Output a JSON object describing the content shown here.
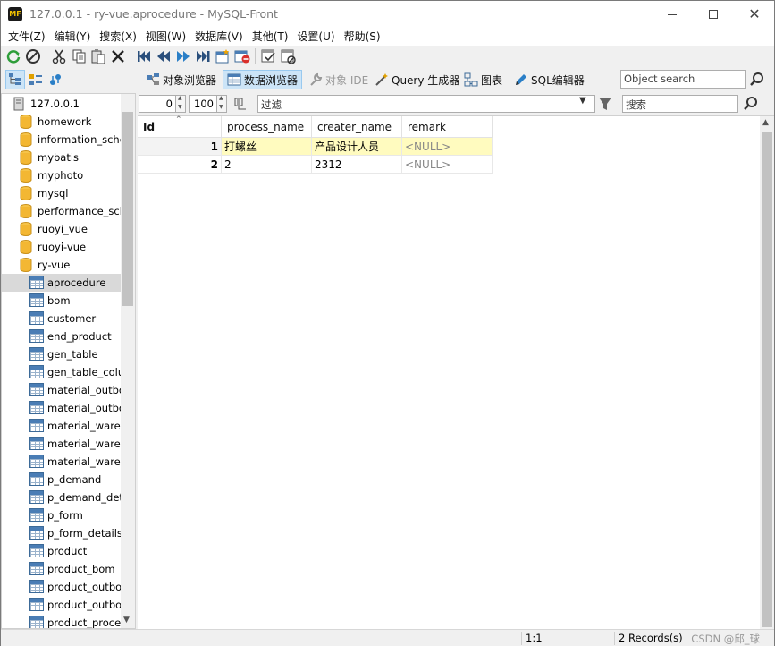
{
  "window": {
    "title": "127.0.0.1 - ry-vue.aprocedure - MySQL-Front",
    "app_icon_text": "MF"
  },
  "menu": [
    "文件(Z)",
    "编辑(Y)",
    "搜索(X)",
    "视图(W)",
    "数据库(V)",
    "其他(T)",
    "设置(U)",
    "帮助(S)"
  ],
  "toolbar_icons": [
    "refresh-icon",
    "stop-icon",
    "cut-icon",
    "copy-icon",
    "paste-icon",
    "delete-icon",
    "first-icon",
    "prev-icon",
    "next-icon",
    "last-icon",
    "insert-record-icon",
    "delete-record-icon",
    "post-icon",
    "cancel-icon"
  ],
  "views": {
    "object_browser": "对象浏览器",
    "data_browser": "数据浏览器",
    "object_ide": "对象 IDE",
    "query_builder": "Query 生成器",
    "diagram": "图表",
    "sql_editor": "SQL编辑器"
  },
  "object_search": {
    "placeholder": "Object search"
  },
  "tree": {
    "server": "127.0.0.1",
    "databases": [
      "homework",
      "information_schema",
      "mybatis",
      "myphoto",
      "mysql",
      "performance_schema",
      "ruoyi_vue",
      "ruoyi-vue",
      "ry-vue"
    ],
    "tables": [
      "aprocedure",
      "bom",
      "customer",
      "end_product",
      "gen_table",
      "gen_table_column",
      "material_outbound",
      "material_outbound",
      "material_warehouse",
      "material_warehouse",
      "material_warehouse",
      "p_demand",
      "p_demand_details",
      "p_form",
      "p_form_details",
      "product",
      "product_bom",
      "product_outbound",
      "product_outbound",
      "product_procedure"
    ],
    "selected": "aprocedure"
  },
  "filter": {
    "offset": "0",
    "limit": "100",
    "filter_label": "过滤",
    "search_label": "搜索"
  },
  "grid": {
    "columns": [
      "Id",
      "process_name",
      "creater_name",
      "remark"
    ],
    "rows": [
      {
        "id": "1",
        "process_name": "打螺丝",
        "creater_name": "产品设计人员",
        "remark": "<NULL>"
      },
      {
        "id": "2",
        "process_name": "2",
        "creater_name": "2312",
        "remark": "<NULL>"
      }
    ]
  },
  "status": {
    "position": "1:1",
    "records": "2 Records(s)",
    "watermark": "CSDN @邱_球"
  },
  "colors": {
    "selection_bg": "#cce4f7",
    "highlight_row": "#fffbbf",
    "null_text": "#888888"
  }
}
